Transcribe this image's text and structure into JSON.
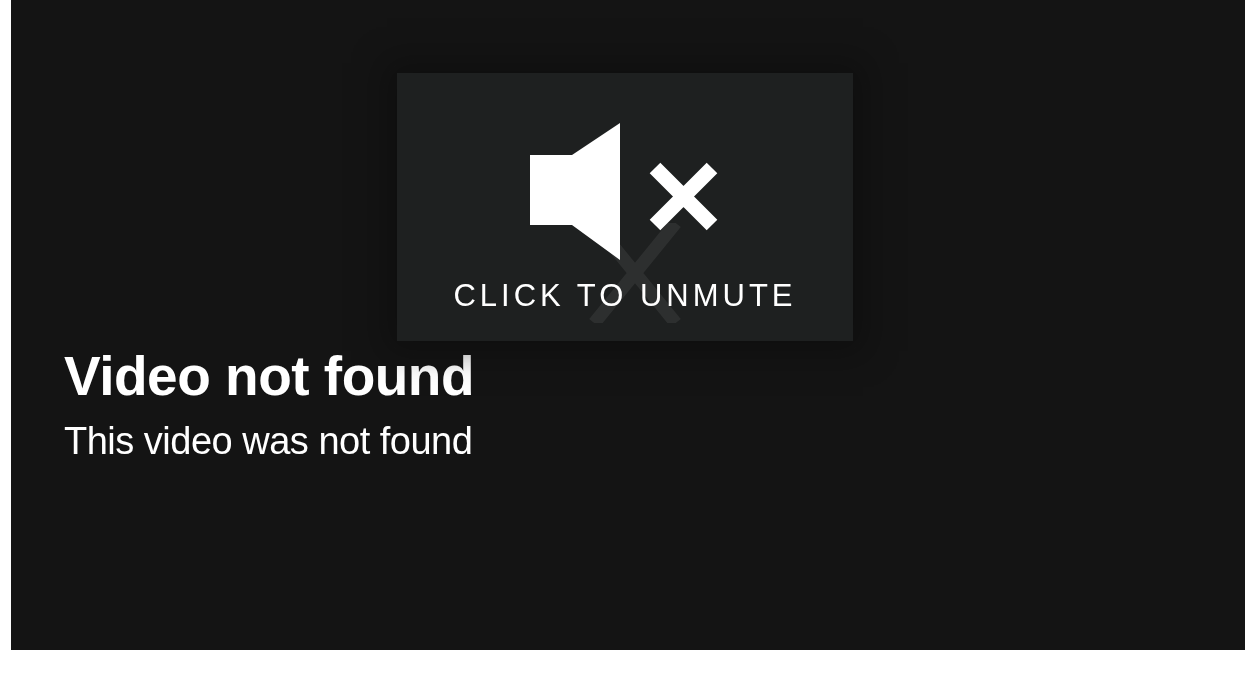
{
  "error": {
    "title": "Video not found",
    "message": "This video was not found"
  },
  "unmute_overlay": {
    "label": "CLICK TO UNMUTE",
    "muted": true
  }
}
